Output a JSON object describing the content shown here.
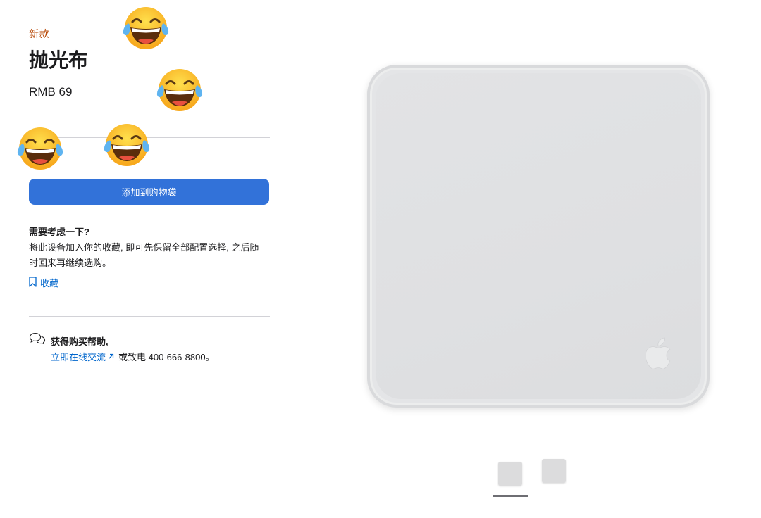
{
  "product": {
    "badge": "新款",
    "name": "抛光布",
    "price": "RMB 69"
  },
  "cart": {
    "add_label": "添加到购物袋"
  },
  "consider": {
    "title": "需要考虑一下?",
    "text": "将此设备加入你的收藏, 即可先保留全部配置选择, 之后随时回来再继续选购。",
    "save_label": "收藏"
  },
  "help": {
    "title": "获得购买帮助,",
    "chat_label": "立即在线交流",
    "phone_text": "或致电 400-666-8800。"
  },
  "gallery": {
    "selected_index": 0,
    "thumbnail_count": 2
  },
  "colors": {
    "accent": "#3272d9",
    "link": "#0066cc",
    "badge": "#b64400"
  },
  "icons": [
    "bookmark-icon",
    "chat-bubbles-icon",
    "external-arrow-icon",
    "laughing-emoji",
    "apple-logo"
  ]
}
